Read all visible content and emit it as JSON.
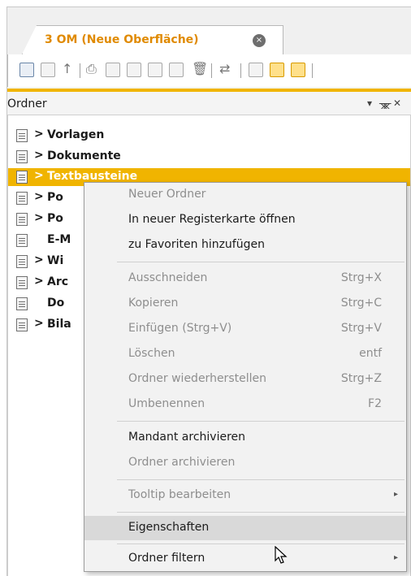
{
  "tab": {
    "title": "3 OM (Neue Oberfläche)",
    "close": "×"
  },
  "panel": {
    "title": "Ordner",
    "dropdown": "▾",
    "pin": "ᚘ",
    "close": "✕"
  },
  "tree": {
    "items": [
      {
        "caret": ">",
        "label": "Vorlagen"
      },
      {
        "caret": ">",
        "label": "Dokumente"
      },
      {
        "caret": ">",
        "label": "Textbausteine",
        "selected": true
      },
      {
        "caret": ">",
        "label": "Po"
      },
      {
        "caret": ">",
        "label": "Po"
      },
      {
        "caret": "",
        "label": "E-M"
      },
      {
        "caret": ">",
        "label": "Wi"
      },
      {
        "caret": ">",
        "label": "Arc"
      },
      {
        "caret": "",
        "label": "Do"
      },
      {
        "caret": ">",
        "label": "Bila"
      }
    ]
  },
  "context_menu": {
    "items": [
      {
        "label": "Neuer Ordner",
        "disabled": true
      },
      {
        "label": "In neuer Registerkarte öffnen"
      },
      {
        "label": "zu Favoriten hinzufügen"
      },
      {
        "label": "Ausschneiden",
        "shortcut": "Strg+X",
        "disabled": true
      },
      {
        "label": "Kopieren",
        "shortcut": "Strg+C",
        "disabled": true
      },
      {
        "label": "Einfügen (Strg+V)",
        "shortcut": "Strg+V",
        "disabled": true
      },
      {
        "label": "Löschen",
        "shortcut": "entf",
        "disabled": true
      },
      {
        "label": "Ordner wiederherstellen",
        "shortcut": "Strg+Z",
        "disabled": true
      },
      {
        "label": "Umbenennen",
        "shortcut": "F2",
        "disabled": true
      },
      {
        "label": "Mandant archivieren"
      },
      {
        "label": "Ordner archivieren",
        "disabled": true
      },
      {
        "label": "Tooltip bearbeiten",
        "submenu": true,
        "disabled": true
      },
      {
        "label": "Eigenschaften",
        "hover": true
      },
      {
        "label": "Ordner filtern",
        "submenu": true
      }
    ],
    "submenu_arrow": "▸"
  },
  "colors": {
    "accent": "#f0b400",
    "tab_title": "#e08a00"
  }
}
